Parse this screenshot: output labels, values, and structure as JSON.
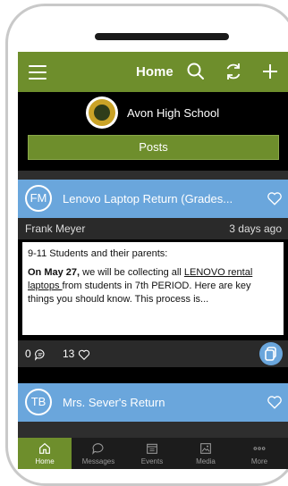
{
  "header": {
    "title": "Home",
    "icons": [
      "menu-icon",
      "search-icon",
      "refresh-icon",
      "plus-icon"
    ]
  },
  "school": {
    "name": "Avon High School",
    "logo": "school-seal-icon"
  },
  "posts_button": {
    "label": "Posts"
  },
  "post1": {
    "avatar": "FM",
    "title": "Lenovo Laptop Return (Grades...",
    "author": "Frank Meyer",
    "time": "3 days ago",
    "body_line1": "9-11 Students and their parents:",
    "body_bold": "On May 27,",
    "body_mid": " we will be collecting all ",
    "body_link": "LENOVO rental laptops ",
    "body_tail": "from students in 7th PERIOD.  Here are key things you should know.  This process is...",
    "comments": "0",
    "likes": "13"
  },
  "post2": {
    "avatar": "TB",
    "title": "Mrs. Sever's Return"
  },
  "tabs": [
    {
      "label": "Home",
      "icon": "home-icon"
    },
    {
      "label": "Messages",
      "icon": "chat-icon"
    },
    {
      "label": "Events",
      "icon": "calendar-icon"
    },
    {
      "label": "Media",
      "icon": "image-icon"
    },
    {
      "label": "More",
      "icon": "more-icon"
    }
  ],
  "colors": {
    "brand_green": "#6e8e2c",
    "post_blue": "#6aa6dc",
    "background": "#000000"
  }
}
